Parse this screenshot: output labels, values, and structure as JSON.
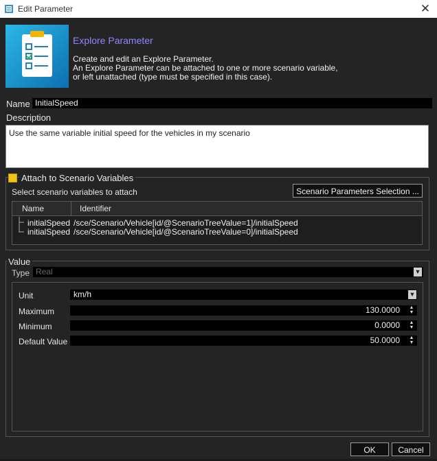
{
  "window": {
    "title": "Edit Parameter"
  },
  "header": {
    "title": "Explore Parameter",
    "lines": [
      "Create and edit an Explore Parameter.",
      "An Explore Parameter can be attached to one or more scenario variable,",
      "or left unattached (type must be specified in this case)."
    ]
  },
  "name": {
    "label": "Name",
    "value": "InitialSpeed"
  },
  "description": {
    "label": "Description",
    "value": "Use the same variable initial speed for the vehicles in my scenario"
  },
  "attach": {
    "label": "Attach to Scenario Variables",
    "checked": true,
    "select_label": "Select scenario variables to attach",
    "selection_button": "Scenario Parameters Selection ...",
    "columns": [
      "Name",
      "Identifier"
    ],
    "rows": [
      {
        "name": "initialSpeed",
        "identifier": "/sce/Scenario/Vehicle[id/@ScenarioTreeValue=1]/initialSpeed"
      },
      {
        "name": "initialSpeed",
        "identifier": "/sce/Scenario/Vehicle[id/@ScenarioTreeValue=0]/initialSpeed"
      }
    ]
  },
  "value": {
    "group_label": "Value",
    "type_label": "Type",
    "type_value": "Real",
    "unit_label": "Unit",
    "unit_value": "km/h",
    "maximum_label": "Maximum",
    "maximum_value": "130.0000",
    "minimum_label": "Minimum",
    "minimum_value": "0.0000",
    "default_label": "Default Value",
    "default_value": "50.0000"
  },
  "buttons": {
    "ok": "OK",
    "cancel": "Cancel"
  },
  "colors": {
    "accent": "#8f87ff",
    "checkbox": "#f0c419",
    "background": "#242424"
  },
  "icons": [
    "app-icon",
    "close-icon",
    "checklist-icon",
    "chevron-down-icon",
    "spin-icon"
  ]
}
